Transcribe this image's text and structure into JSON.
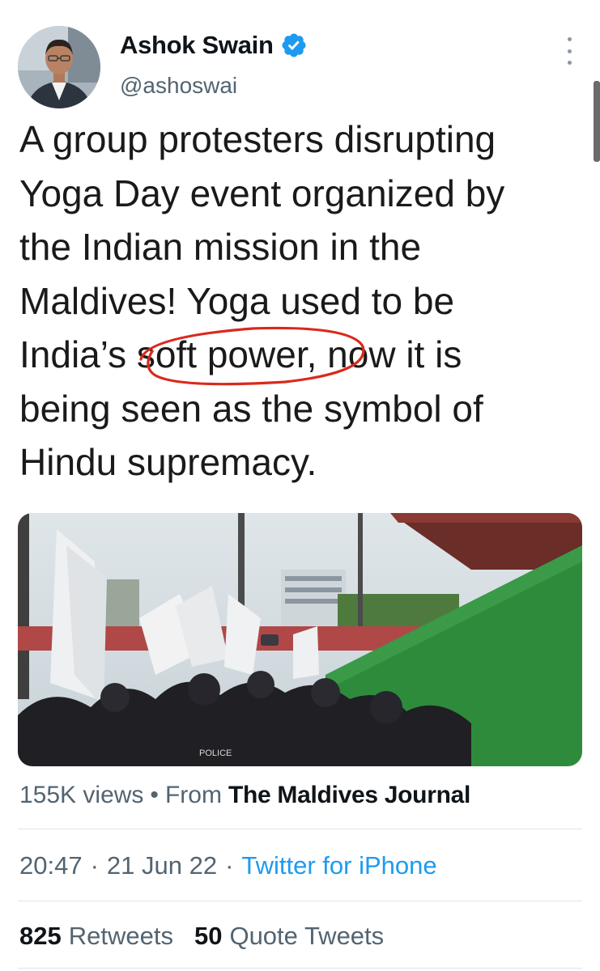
{
  "author": {
    "name": "Ashok Swain",
    "handle": "@ashoswai",
    "verified": true,
    "verified_color": "#1d9bf0"
  },
  "tweet": {
    "text_before": "A group protesters disrupting\nYoga Day event organized by\nthe Indian mission in the\nMaldives! Yoga used to be\nIndia’s ",
    "text_highlighted": "soft power,",
    "text_after": " now it is\nbeing seen as the symbol of\nHindu supremacy.",
    "annotation_color": "#d9291c"
  },
  "media": {
    "type": "video",
    "overlay_text": "POLICE"
  },
  "meta": {
    "views": "155K views",
    "separator": "•",
    "from_label": "From",
    "source": "The Maldives Journal",
    "time": "20:47",
    "dot": "·",
    "date": "21 Jun 22",
    "client": "Twitter for iPhone",
    "client_color": "#1d9bf0"
  },
  "stats": {
    "retweets_count": "825",
    "retweets_label": "Retweets",
    "quotes_count": "50",
    "quotes_label": "Quote Tweets"
  }
}
